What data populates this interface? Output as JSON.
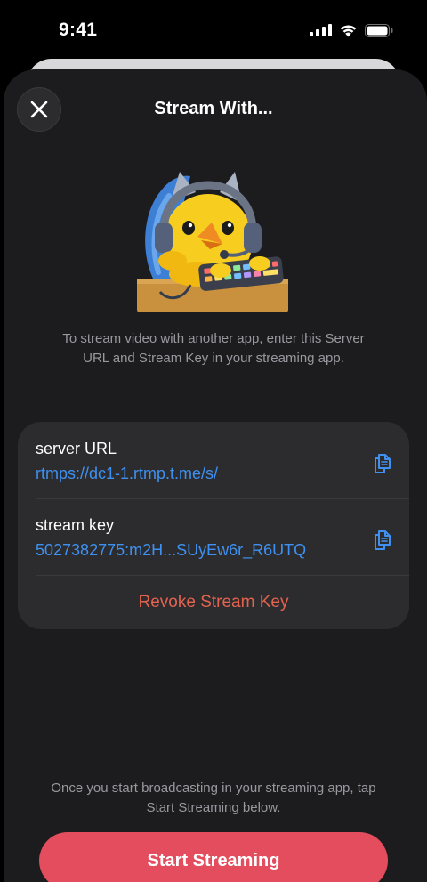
{
  "status_bar": {
    "time": "9:41",
    "icons": [
      "cellular-signal-icon",
      "wifi-icon",
      "battery-icon"
    ]
  },
  "sheet": {
    "title": "Stream With...",
    "close_icon": "close-icon",
    "sticker": "duck-streamer-sticker"
  },
  "info_text": "To stream video with another app, enter this Server URL and Stream Key in your streaming app.",
  "card": {
    "server_url": {
      "label": "server URL",
      "value": "rtmps://dc1-1.rtmp.t.me/s/",
      "action_icon": "copy-icon"
    },
    "stream_key": {
      "label": "stream key",
      "value": "5027382775:m2H...SUyEw6r_R6UTQ",
      "action_icon": "copy-icon"
    },
    "revoke_label": "Revoke Stream Key"
  },
  "footer_text": "Once you start broadcasting in your streaming app, tap Start Streaming below.",
  "start_button_label": "Start Streaming",
  "colors": {
    "background": "#000000",
    "sheet": "#1c1c1e",
    "card": "#2c2c2e",
    "link": "#3e91f2",
    "destructive": "#e3634f",
    "primary_button": "#e34d5d",
    "secondary_text": "#98989f"
  }
}
